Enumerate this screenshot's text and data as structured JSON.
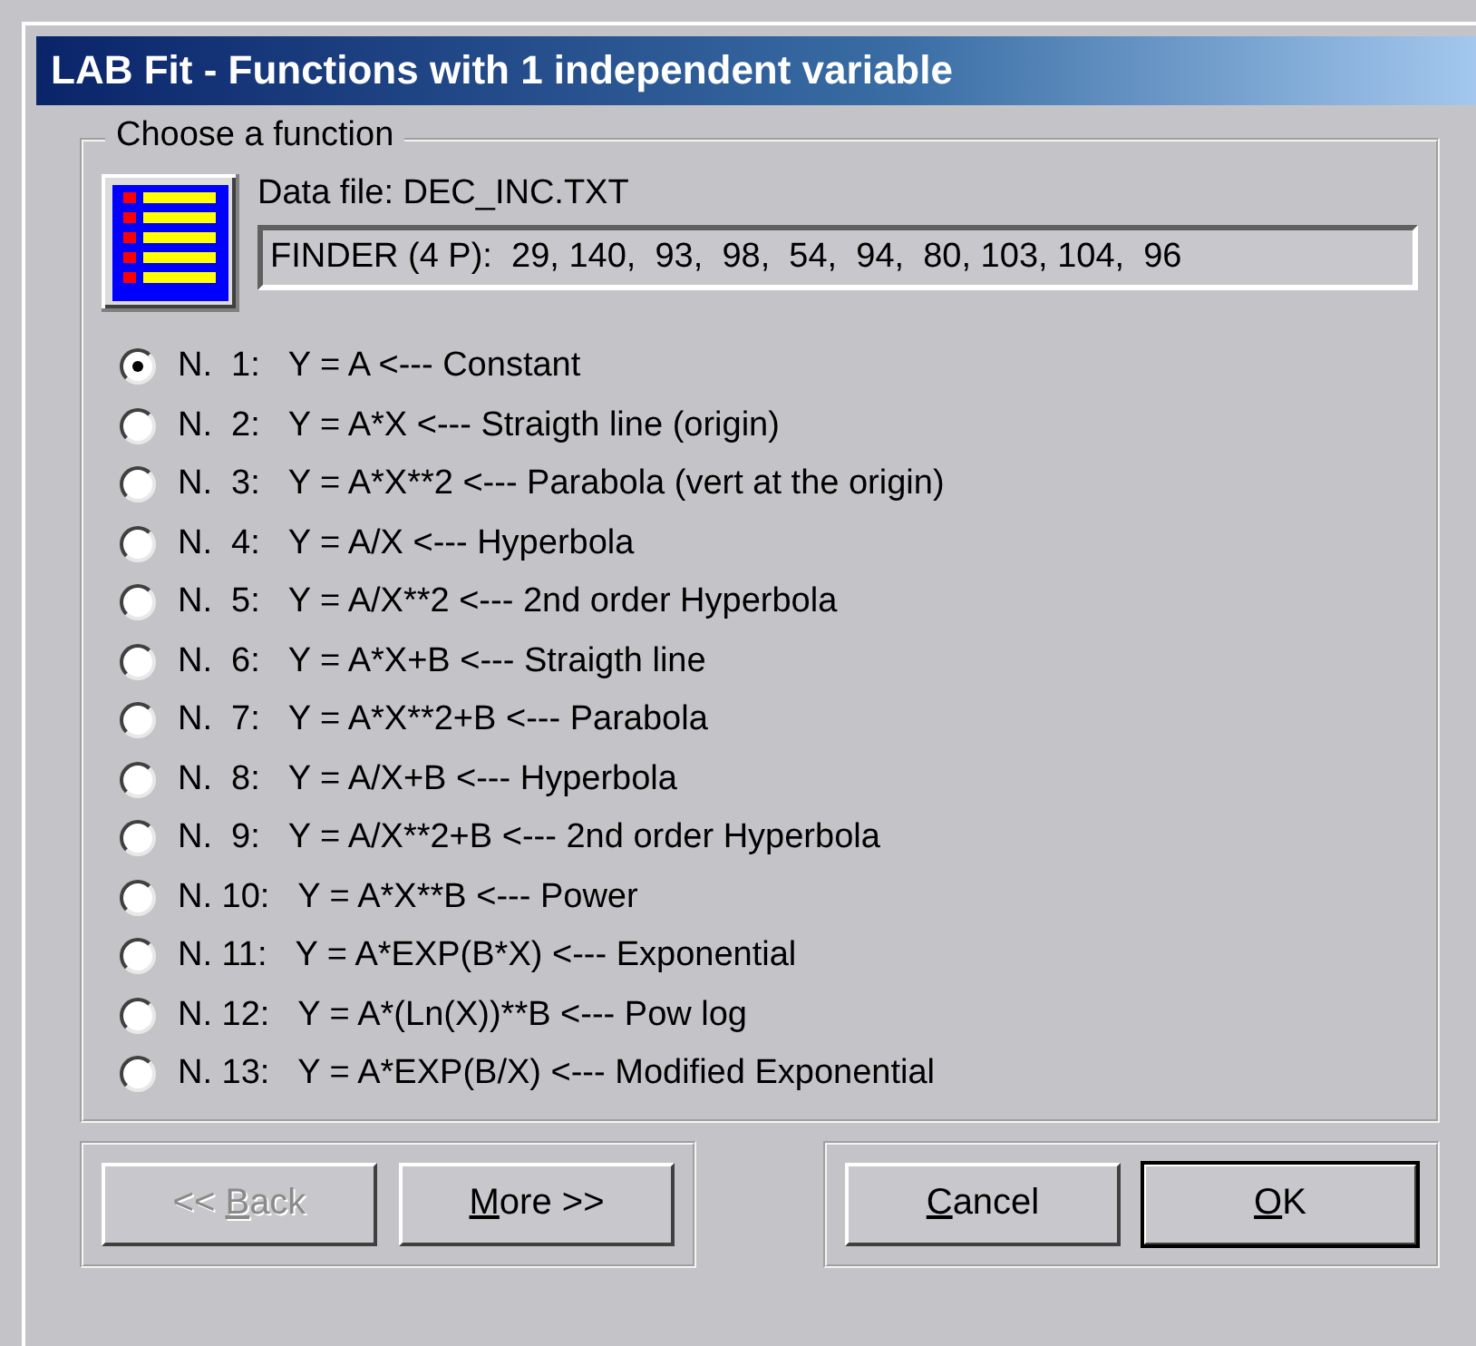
{
  "window": {
    "title": "LAB Fit - Functions with 1 independent variable"
  },
  "group": {
    "label": "Choose a function"
  },
  "data_file": "Data file: DEC_INC.TXT",
  "finder": {
    "value": "FINDER (4 P):  29, 140,  93,  98,  54,  94,  80, 103, 104,  96"
  },
  "functions": [
    {
      "label": "N.  1:   Y = A <--- Constant",
      "selected": true
    },
    {
      "label": "N.  2:   Y = A*X <--- Straigth line (origin)",
      "selected": false
    },
    {
      "label": "N.  3:   Y = A*X**2 <--- Parabola (vert at the origin)",
      "selected": false
    },
    {
      "label": "N.  4:   Y = A/X <--- Hyperbola",
      "selected": false
    },
    {
      "label": "N.  5:   Y = A/X**2 <--- 2nd order Hyperbola",
      "selected": false
    },
    {
      "label": "N.  6:   Y = A*X+B <--- Straigth line",
      "selected": false
    },
    {
      "label": "N.  7:   Y = A*X**2+B <--- Parabola",
      "selected": false
    },
    {
      "label": "N.  8:   Y = A/X+B <--- Hyperbola",
      "selected": false
    },
    {
      "label": "N.  9:   Y = A/X**2+B <--- 2nd order Hyperbola",
      "selected": false
    },
    {
      "label": "N. 10:   Y = A*X**B <--- Power",
      "selected": false
    },
    {
      "label": "N. 11:   Y = A*EXP(B*X) <--- Exponential",
      "selected": false
    },
    {
      "label": "N. 12:   Y = A*(Ln(X))**B <--- Pow log",
      "selected": false
    },
    {
      "label": "N. 13:   Y = A*EXP(B/X) <--- Modified Exponential",
      "selected": false
    }
  ],
  "nav_buttons": [
    {
      "before": "<< ",
      "key": "B",
      "after": "ack",
      "disabled": true,
      "default": false
    },
    {
      "key": "M",
      "after": "ore >>",
      "disabled": false,
      "default": false
    }
  ],
  "dialog_buttons": [
    {
      "key": "C",
      "after": "ancel",
      "disabled": false,
      "default": false
    },
    {
      "key": "O",
      "after": "K",
      "disabled": false,
      "default": true
    }
  ]
}
